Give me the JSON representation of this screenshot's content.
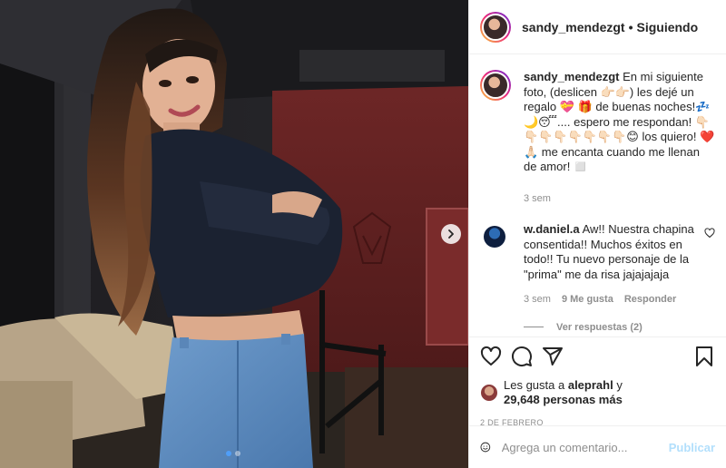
{
  "header": {
    "username": "sandy_mendezgt",
    "separator": "•",
    "follow_status": "Siguiendo"
  },
  "caption": {
    "username": "sandy_mendezgt",
    "text": "En mi siguiente foto, (deslicen 👉🏻👉🏻) les dejé un regalo 💝 🎁 de buenas noches!💤 🌙😴.... espero me respondan! 👇🏻👇🏻👇🏻👇🏻👇🏻👇🏻👇🏻👇🏻😊 los quiero! ❤️🙏🏻 me encanta cuando me llenan de amor! ◻️",
    "time": "3 sem"
  },
  "comment": {
    "username": "w.daniel.a",
    "text": "Aw!! Nuestra chapina consentida!! Muchos éxitos en todo!! Tu nuevo personaje de la \"prima\" me da risa jajajajaja",
    "time": "3 sem",
    "likes": "9 Me gusta",
    "reply": "Responder",
    "view_replies": "Ver respuestas (2)"
  },
  "actions": {
    "icons": [
      "heart-icon",
      "comment-icon",
      "share-icon",
      "bookmark-icon"
    ]
  },
  "likes": {
    "prefix": "Les gusta a",
    "liker": "aleprahl",
    "conj": "y",
    "count": "29,648 personas más"
  },
  "date": "2 DE FEBRERO",
  "add_comment": {
    "placeholder": "Agrega un comentario...",
    "publish": "Publicar"
  },
  "carousel": {
    "slides": 2,
    "active": 1
  },
  "colors": {
    "accent": "#0095f6",
    "publish_disabled": "#b2dffc",
    "muted": "#8e8e8e",
    "text": "#262626",
    "border": "#efefef"
  }
}
